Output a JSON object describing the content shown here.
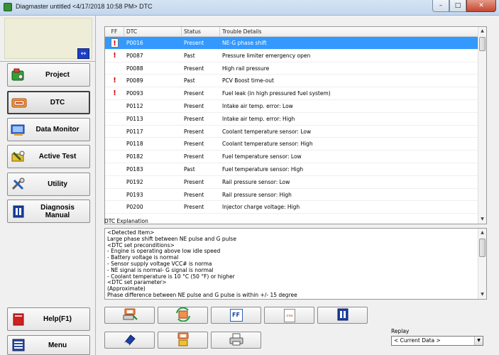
{
  "window": {
    "title": "Diagmaster untitled <4/17/2018 10:58 PM> DTC",
    "minimize": "–",
    "maximize": "□",
    "close": "✕"
  },
  "sidebar": {
    "toggle_glyph": "↔",
    "nav": [
      {
        "label": "Project",
        "icon": "project-icon",
        "active": false
      },
      {
        "label": "DTC",
        "icon": "dtc-icon",
        "active": true
      },
      {
        "label": "Data Monitor",
        "icon": "data-monitor-icon",
        "active": false
      },
      {
        "label": "Active Test",
        "icon": "active-test-icon",
        "active": false
      },
      {
        "label": "Utility",
        "icon": "utility-icon",
        "active": false
      },
      {
        "label": "Diagnosis Manual",
        "icon": "manual-icon",
        "active": false
      }
    ],
    "help_label": "Help(F1)",
    "menu_label": "Menu"
  },
  "dtc_table": {
    "columns": [
      "FF",
      "DTC",
      "Status",
      "Trouble Details"
    ],
    "rows": [
      {
        "ff": "!",
        "dtc": "P0016",
        "status": "Present",
        "detail": "NE-G phase shift",
        "selected": true
      },
      {
        "ff": "!",
        "dtc": "P0087",
        "status": "Past",
        "detail": "Pressure limiter emergency open"
      },
      {
        "ff": "",
        "dtc": "P0088",
        "status": "Present",
        "detail": "High rail pressure"
      },
      {
        "ff": "!",
        "dtc": "P0089",
        "status": "Past",
        "detail": "PCV Boost time-out"
      },
      {
        "ff": "!",
        "dtc": "P0093",
        "status": "Present",
        "detail": "Fuel leak (in high pressured fuel system)"
      },
      {
        "ff": "",
        "dtc": "P0112",
        "status": "Present",
        "detail": "Intake air temp. error: Low"
      },
      {
        "ff": "",
        "dtc": "P0113",
        "status": "Present",
        "detail": "Intake air temp. error: High"
      },
      {
        "ff": "",
        "dtc": "P0117",
        "status": "Present",
        "detail": "Coolant temperature sensor: Low"
      },
      {
        "ff": "",
        "dtc": "P0118",
        "status": "Present",
        "detail": "Coolant temperature sensor: High"
      },
      {
        "ff": "",
        "dtc": "P0182",
        "status": "Present",
        "detail": "Fuel temperature sensor: Low"
      },
      {
        "ff": "",
        "dtc": "P0183",
        "status": "Past",
        "detail": "Fuel temperature sensor: High"
      },
      {
        "ff": "",
        "dtc": "P0192",
        "status": "Present",
        "detail": "Rail pressure sensor: Low"
      },
      {
        "ff": "",
        "dtc": "P0193",
        "status": "Present",
        "detail": "Rail pressure sensor: High"
      },
      {
        "ff": "",
        "dtc": "P0200",
        "status": "Present",
        "detail": "Injector charge voltage: High"
      }
    ]
  },
  "explanation": {
    "label": "DTC Explanation",
    "lines": [
      "<Detected Item>",
      "Large phase shift between NE pulse and G pulse",
      "<DTC set preconditions>",
      "- Engine is operating above low idle speed",
      "- Battery voltage is normal",
      "- Sensor supply voltage VCC# is norma",
      "- NE signal is normal- G signal is normal",
      "- Coolant temperature is 10 °C (50 °F) or higher",
      "<DTC set parameter>",
      " (Approximate)",
      "Phase difference between NE pulse and G pulse is within +/- 15 degree"
    ]
  },
  "toolbar": {
    "ff_label": "FF",
    "csv_label": ".csv"
  },
  "replay": {
    "label": "Replay",
    "value": "< Current Data >"
  },
  "colors": {
    "selection": "#3399ff",
    "alert": "#d00000"
  }
}
